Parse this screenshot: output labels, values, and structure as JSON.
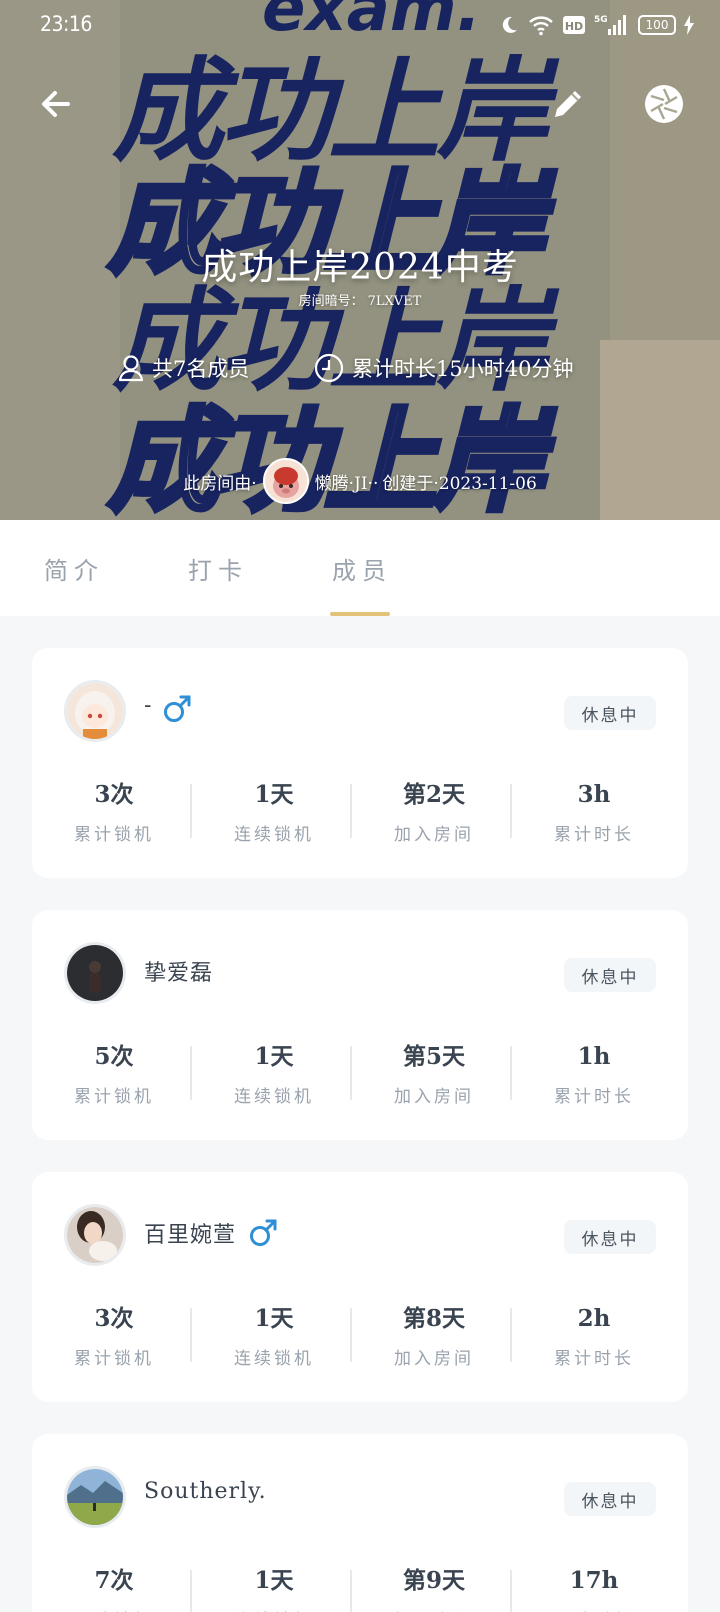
{
  "status_bar": {
    "time": "23:16",
    "network": "5G",
    "hd": "HD",
    "battery": "100"
  },
  "room": {
    "title": "成功上岸2024中考",
    "code_label": "房间暗号：",
    "code": "7LXVET",
    "members_text": "共7名成员",
    "duration_text": "累计时长15小时40分钟",
    "creator_prefix": "此房间由·",
    "creator_name": "懒腾·JI··",
    "created_text": "创建于·2023-11-06",
    "background_art_text": [
      "exam.",
      "成功上岸",
      "成功上岸",
      "成功上岸",
      "成功上岸"
    ]
  },
  "tabs": [
    {
      "label": "简介",
      "active": false
    },
    {
      "label": "打卡",
      "active": false
    },
    {
      "label": "成员",
      "active": true
    }
  ],
  "colors": {
    "accent_underline": "#e3c27a",
    "male_icon": "#2e8fd6",
    "hero_bg": "#a8a792",
    "hero_text_blue": "#1c2a6e"
  },
  "metric_labels": [
    "累计锁机",
    "连续锁机",
    "加入房间",
    "累计时长"
  ],
  "members": [
    {
      "name": "-",
      "gender": "male",
      "status": "休息中",
      "lock_count": "3次",
      "streak": "1天",
      "joined": "第2天",
      "total_time": "3h"
    },
    {
      "name": "挚爱磊",
      "gender": "",
      "status": "休息中",
      "lock_count": "5次",
      "streak": "1天",
      "joined": "第5天",
      "total_time": "1h"
    },
    {
      "name": "百里婉萱",
      "gender": "male",
      "status": "休息中",
      "lock_count": "3次",
      "streak": "1天",
      "joined": "第8天",
      "total_time": "2h"
    },
    {
      "name": "Southerly.",
      "gender": "",
      "status": "休息中",
      "lock_count": "7次",
      "streak": "1天",
      "joined": "第9天",
      "total_time": "17h"
    }
  ]
}
